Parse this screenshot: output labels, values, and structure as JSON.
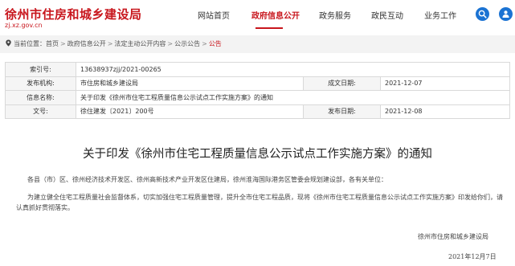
{
  "site": {
    "title": "徐州市住房和城乡建设局",
    "domain": "zj.xz.gov.cn"
  },
  "nav": {
    "items": [
      "网站首页",
      "政府信息公开",
      "政务服务",
      "政民互动",
      "业务工作"
    ],
    "active_index": 1
  },
  "header_buttons": {
    "search_icon": "search-icon",
    "user_icon": "user-icon",
    "color": "#1b73d3"
  },
  "breadcrumb": {
    "prefix": "当前位置：",
    "items": [
      "首页",
      "政府信息公开",
      "法定主动公开内容",
      "公示公告",
      "公告"
    ],
    "separator": ">"
  },
  "info": {
    "index_label": "索引号:",
    "index_value": "13638937zjj/2021-00265",
    "publisher_label": "发布机构:",
    "publisher_value": "市住房和城乡建设局",
    "created_label": "成文日期:",
    "created_value": "2021-12-07",
    "name_label": "信息名称:",
    "name_value": "关于印发《徐州市住宅工程质量信息公示试点工作实施方案》的通知",
    "docno_label": "文号:",
    "docno_value": "徐住建发〔2021〕200号",
    "published_label": "发布日期:",
    "published_value": "2021-12-08"
  },
  "article": {
    "title": "关于印发《徐州市住宅工程质量信息公示试点工作实施方案》的通知",
    "paragraph1": "各县（市）区、徐州经济技术开发区、徐州高新技术产业开发区住建局，徐州淮海国际港务区管委会规划建设部，各有关单位：",
    "paragraph2": "为建立健全住宅工程质量社会监督体系，切实加强住宅工程质量管理，提升全市住宅工程品质，现将《徐州市住宅工程质量信息公示试点工作实施方案》印发给你们，请认真抓好贯彻落实。",
    "signature_org": "徐州市住房和城乡建设局",
    "signature_date": "2021年12月7日"
  },
  "colors": {
    "brand_red": "#c8161d",
    "breadcrumb_bg": "#f3f3f3",
    "label_bg": "#f5f5f5"
  }
}
